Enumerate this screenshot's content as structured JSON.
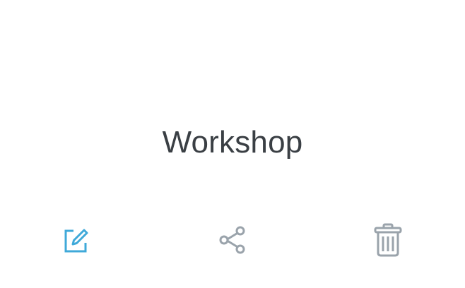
{
  "card": {
    "title": "Workshop",
    "title_color": "#3a3f44"
  },
  "actions": [
    {
      "name": "edit",
      "icon": "edit-icon",
      "color": "#3fa9d9"
    },
    {
      "name": "share",
      "icon": "share-icon",
      "color": "#9aa3ab"
    },
    {
      "name": "delete",
      "icon": "trash-icon",
      "color": "#9aa3ab"
    }
  ]
}
